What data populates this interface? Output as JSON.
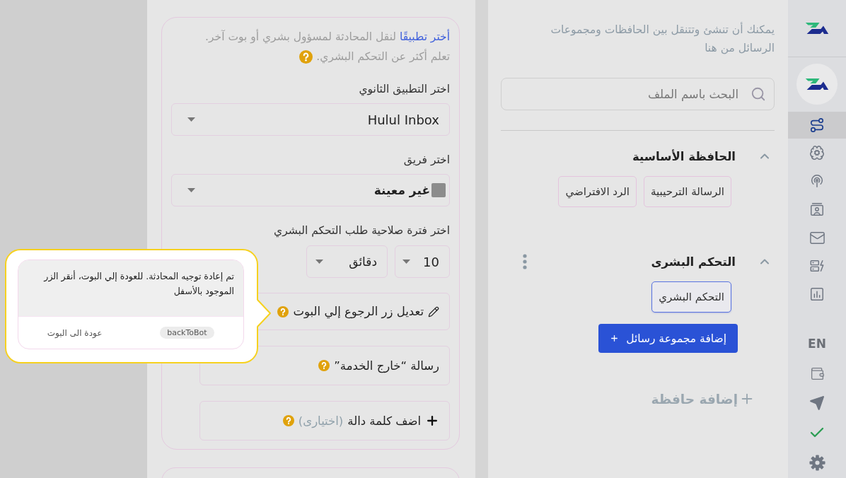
{
  "sidebar": {
    "nav_items": [
      {
        "kind": "flow",
        "selected": true
      },
      {
        "kind": "brain",
        "selected": false
      },
      {
        "kind": "broadcast",
        "selected": false
      },
      {
        "kind": "contacts",
        "selected": false
      },
      {
        "kind": "inbox",
        "selected": false
      },
      {
        "kind": "servers",
        "selected": false
      },
      {
        "kind": "analytics",
        "selected": false
      }
    ],
    "language": "EN",
    "utility_items": [
      {
        "kind": "wallet"
      },
      {
        "kind": "send"
      },
      {
        "kind": "check"
      },
      {
        "kind": "settings"
      }
    ]
  },
  "flows_panel": {
    "description": "يمكنك أن تنشئ وتتنقل بين الحافظات ومجموعات الرسائل من هنا",
    "search": {
      "placeholder": "البحث باسم الملف"
    },
    "folders": [
      {
        "title": "الحافظة الأساسية",
        "expanded": true,
        "show_menu": false,
        "groups": [
          {
            "label": "الرسالة الترحيبية",
            "selected": false
          },
          {
            "label": "الرد الافتراضي",
            "selected": false
          }
        ]
      },
      {
        "title": "التحكم البشرى",
        "expanded": true,
        "show_menu": true,
        "groups": [
          {
            "label": "التحكم البشري",
            "selected": true
          }
        ],
        "add_group_button": "إضافة مجموعة رسائل"
      }
    ],
    "add_folder_button": "إضافة حافظة"
  },
  "human_takeover": {
    "intro": {
      "link": "أختر تطبيقًا",
      "text": "لنقل المحادثة لمسؤول بشري أو بوت آخر.",
      "learn_more": "تعلم أكثر عن التحكم البشري."
    },
    "secondary_app": {
      "label": "اختر التطبيق الثانوي",
      "value": "Hulul Inbox"
    },
    "team": {
      "label": "اختر فريق",
      "value": "غير معينة"
    },
    "expiry": {
      "label": "اختر فترة صلاحية طلب التحكم البشري",
      "amount": "10",
      "unit": "دقائق"
    },
    "options": [
      {
        "kind": "edit",
        "label": "تعديل زر الرجوع إلي البوت"
      },
      {
        "kind": "message",
        "label": "رسالة “خارج الخدمة”"
      },
      {
        "kind": "add",
        "label": "اضف كلمة دالة",
        "note": "(اختيارى)"
      }
    ]
  },
  "tooltip": {
    "message": "تم إعادة توجيه المحادثة. للعودة إلي البوت، أنقر الزر الموجود بالأسفل",
    "payload": "backToBot",
    "title": "عودة الى البوت"
  }
}
